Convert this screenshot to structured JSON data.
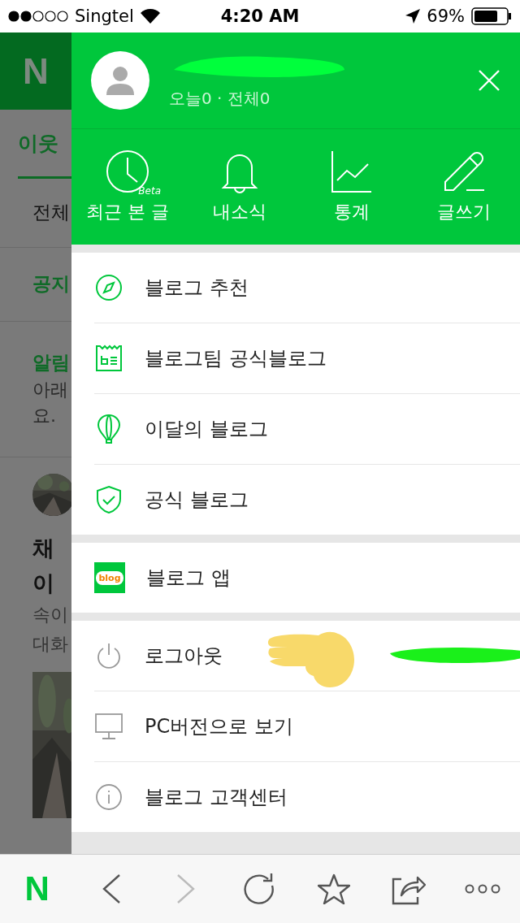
{
  "status_bar": {
    "carrier": "Singtel",
    "time": "4:20 AM",
    "battery": "69%"
  },
  "background_page": {
    "logo": "N",
    "tab": "이웃",
    "filter": "전체",
    "notice": "공지",
    "alert_title": "알림",
    "alert_lines": [
      "아래",
      "요."
    ],
    "post_title_lines": [
      "채",
      "이"
    ],
    "post_lines": [
      "속이",
      "대화"
    ]
  },
  "drawer": {
    "stats": "오늘0 · 전체0",
    "shortcuts": [
      {
        "label": "최근 본 글",
        "badge": "Beta"
      },
      {
        "label": "내소식"
      },
      {
        "label": "통계"
      },
      {
        "label": "글쓰기"
      }
    ],
    "menu_groups": [
      {
        "items": [
          {
            "label": "블로그 추천"
          },
          {
            "label": "블로그팀 공식블로그"
          },
          {
            "label": "이달의 블로그"
          },
          {
            "label": "공식 블로그"
          }
        ]
      },
      {
        "items": [
          {
            "label": "블로그 앱",
            "app_icon_text": "blog"
          }
        ]
      },
      {
        "items": [
          {
            "label": "로그아웃"
          },
          {
            "label": "PC버전으로 보기"
          },
          {
            "label": "블로그 고객센터"
          }
        ]
      }
    ]
  },
  "toolbar": {
    "logo": "N",
    "forward_disabled": true
  }
}
